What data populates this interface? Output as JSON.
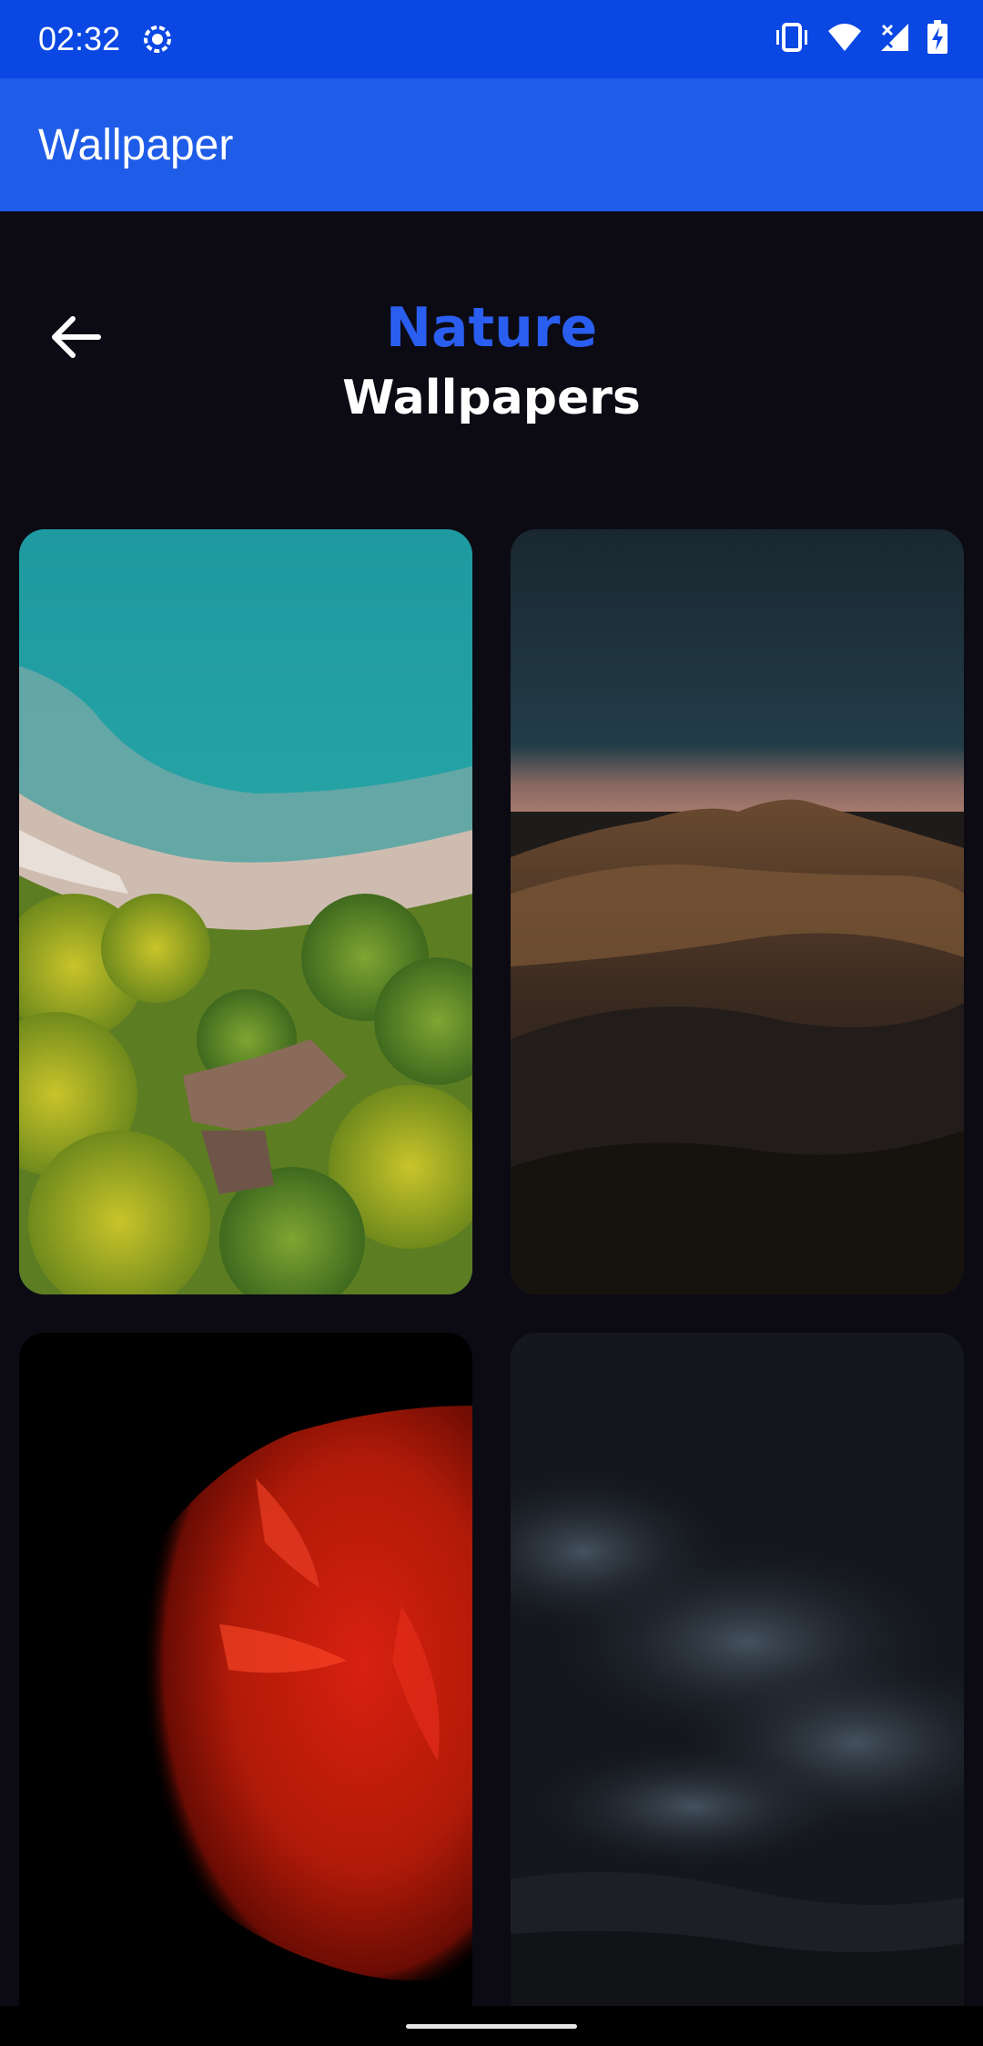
{
  "status_bar": {
    "time": "02:32",
    "icons": [
      "screen-record-icon",
      "vibrate-icon",
      "wifi-icon",
      "signal-icon",
      "battery-charging-icon"
    ]
  },
  "app_bar": {
    "title": "Wallpaper"
  },
  "header": {
    "category": "Nature",
    "subtitle": "Wallpapers",
    "back_icon": "arrow-left-icon"
  },
  "colors": {
    "status_bar": "#0a47e3",
    "app_bar": "#1f5ce8",
    "background": "#0c0b14",
    "accent_title": "#2a5ef0"
  },
  "wallpapers": [
    {
      "subject": "aerial-beach-forest"
    },
    {
      "subject": "mountain-dusk"
    },
    {
      "subject": "red-betta-fish"
    },
    {
      "subject": "night-sky-clouds"
    }
  ]
}
